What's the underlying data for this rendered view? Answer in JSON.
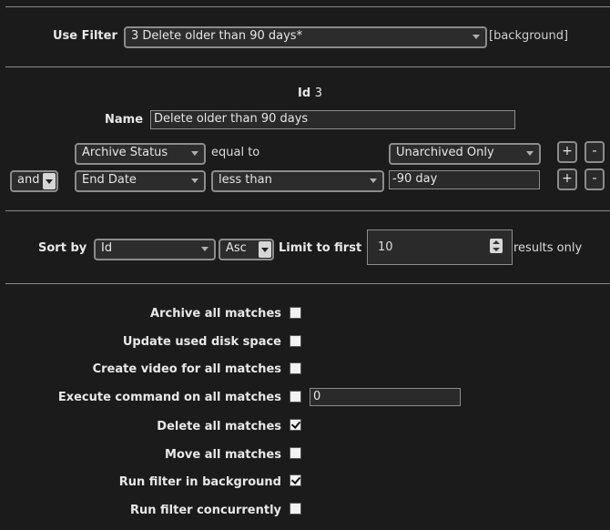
{
  "filter": {
    "use_filter_label": "Use Filter",
    "selected": "3 Delete older than 90 days*",
    "background_tag": "[background]"
  },
  "details": {
    "id_label": "Id",
    "id_value": "3",
    "name_label": "Name",
    "name_value": "Delete older than 90 days"
  },
  "terms": [
    {
      "conj": "",
      "attr": "Archive Status",
      "op_text": "equal to",
      "value_select": "Unarchived Only"
    },
    {
      "conj": "and",
      "attr": "End Date",
      "op_select": "less than",
      "value_text": "-90 day"
    }
  ],
  "term_buttons": {
    "add": "+",
    "remove": "-"
  },
  "sort": {
    "label": "Sort by",
    "field": "Id",
    "direction": "Asc",
    "limit_label": "Limit to first",
    "limit_value": "10",
    "results_label": "results only"
  },
  "actions": [
    {
      "label": "Archive all matches",
      "checked": false
    },
    {
      "label": "Update used disk space",
      "checked": false
    },
    {
      "label": "Create video for all matches",
      "checked": false
    },
    {
      "label": "Execute command on all matches",
      "checked": false,
      "input_value": "0"
    },
    {
      "label": "Delete all matches",
      "checked": true
    },
    {
      "label": "Move all matches",
      "checked": false
    },
    {
      "label": "Run filter in background",
      "checked": true
    },
    {
      "label": "Run filter concurrently",
      "checked": false
    }
  ]
}
